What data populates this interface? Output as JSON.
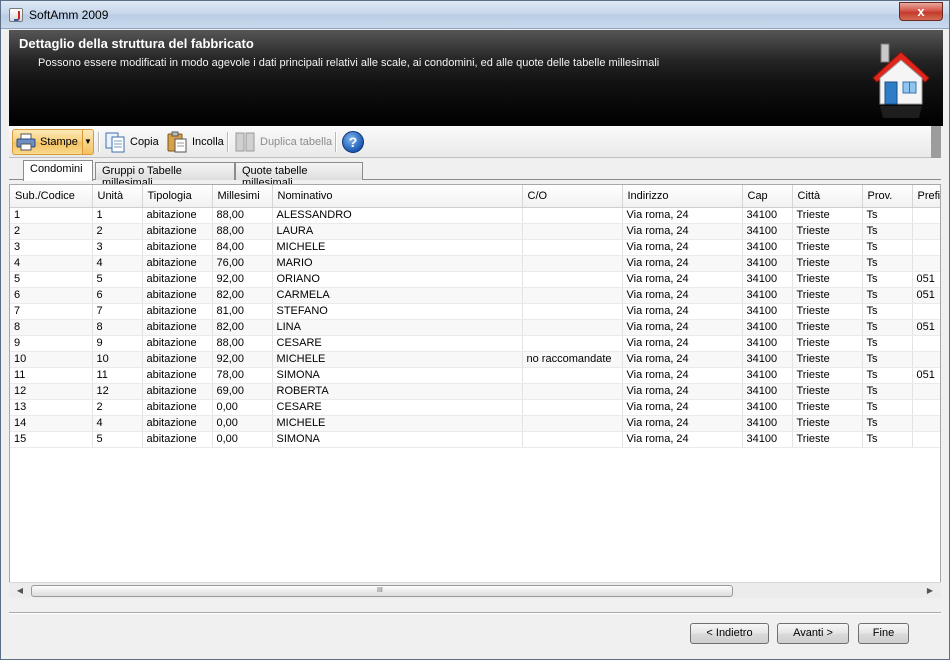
{
  "window": {
    "title": "SoftAmm 2009",
    "close": "x"
  },
  "banner": {
    "title": "Dettaglio della struttura del fabbricato",
    "subtitle": "Possono essere modificati in modo agevole i dati principali relativi alle scale, ai condomini, ed alle quote delle tabelle millesimali",
    "icon": "house-icon"
  },
  "toolbar": {
    "stampe": "Stampe",
    "copia": "Copia",
    "incolla": "Incolla",
    "duplica": "Duplica tabella",
    "help": "?"
  },
  "tabs": [
    {
      "label": "Condomini",
      "active": true
    },
    {
      "label": "Gruppi o Tabelle millesimali",
      "active": false
    },
    {
      "label": "Quote tabelle millesimali",
      "active": false
    }
  ],
  "table": {
    "columns": [
      "Sub./Codice",
      "Unità",
      "Tipologia",
      "Millesimi",
      "Nominativo",
      "C/O",
      "Indirizzo",
      "Cap",
      "Città",
      "Prov.",
      "Prefi"
    ],
    "rows": [
      [
        "1",
        "1",
        "abitazione",
        "88,00",
        "ALESSANDRO",
        "",
        "Via roma, 24",
        "34100",
        "Trieste",
        "Ts",
        ""
      ],
      [
        "2",
        "2",
        "abitazione",
        "88,00",
        "LAURA",
        "",
        "Via roma, 24",
        "34100",
        "Trieste",
        "Ts",
        ""
      ],
      [
        "3",
        "3",
        "abitazione",
        "84,00",
        "MICHELE",
        "",
        "Via roma, 24",
        "34100",
        "Trieste",
        "Ts",
        ""
      ],
      [
        "4",
        "4",
        "abitazione",
        "76,00",
        "MARIO",
        "",
        "Via roma, 24",
        "34100",
        "Trieste",
        "Ts",
        ""
      ],
      [
        "5",
        "5",
        "abitazione",
        "92,00",
        "ORIANO",
        "",
        "Via roma, 24",
        "34100",
        "Trieste",
        "Ts",
        "051"
      ],
      [
        "6",
        "6",
        "abitazione",
        "82,00",
        "CARMELA",
        "",
        "Via roma, 24",
        "34100",
        "Trieste",
        "Ts",
        "051"
      ],
      [
        "7",
        "7",
        "abitazione",
        "81,00",
        "STEFANO",
        "",
        "Via roma, 24",
        "34100",
        "Trieste",
        "Ts",
        ""
      ],
      [
        "8",
        "8",
        "abitazione",
        "82,00",
        "LINA",
        "",
        "Via roma, 24",
        "34100",
        "Trieste",
        "Ts",
        "051"
      ],
      [
        "9",
        "9",
        "abitazione",
        "88,00",
        "CESARE",
        "",
        "Via roma, 24",
        "34100",
        "Trieste",
        "Ts",
        ""
      ],
      [
        "10",
        "10",
        "abitazione",
        "92,00",
        "MICHELE",
        "no raccomandate",
        "Via roma, 24",
        "34100",
        "Trieste",
        "Ts",
        ""
      ],
      [
        "11",
        "11",
        "abitazione",
        "78,00",
        "SIMONA",
        "",
        "Via roma, 24",
        "34100",
        "Trieste",
        "Ts",
        "051"
      ],
      [
        "12",
        "12",
        "abitazione",
        "69,00",
        "ROBERTA",
        "",
        "Via roma, 24",
        "34100",
        "Trieste",
        "Ts",
        ""
      ],
      [
        "13",
        "2",
        "abitazione",
        "0,00",
        "CESARE",
        "",
        "Via roma, 24",
        "34100",
        "Trieste",
        "Ts",
        ""
      ],
      [
        "14",
        "4",
        "abitazione",
        "0,00",
        "MICHELE",
        "",
        "Via roma, 24",
        "34100",
        "Trieste",
        "Ts",
        ""
      ],
      [
        "15",
        "5",
        "abitazione",
        "0,00",
        "SIMONA",
        "",
        "Via roma, 24",
        "34100",
        "Trieste",
        "Ts",
        ""
      ]
    ]
  },
  "scrollbar": {
    "grip": "III"
  },
  "buttons": {
    "back": "< Indietro",
    "next": "Avanti >",
    "finish": "Fine"
  }
}
